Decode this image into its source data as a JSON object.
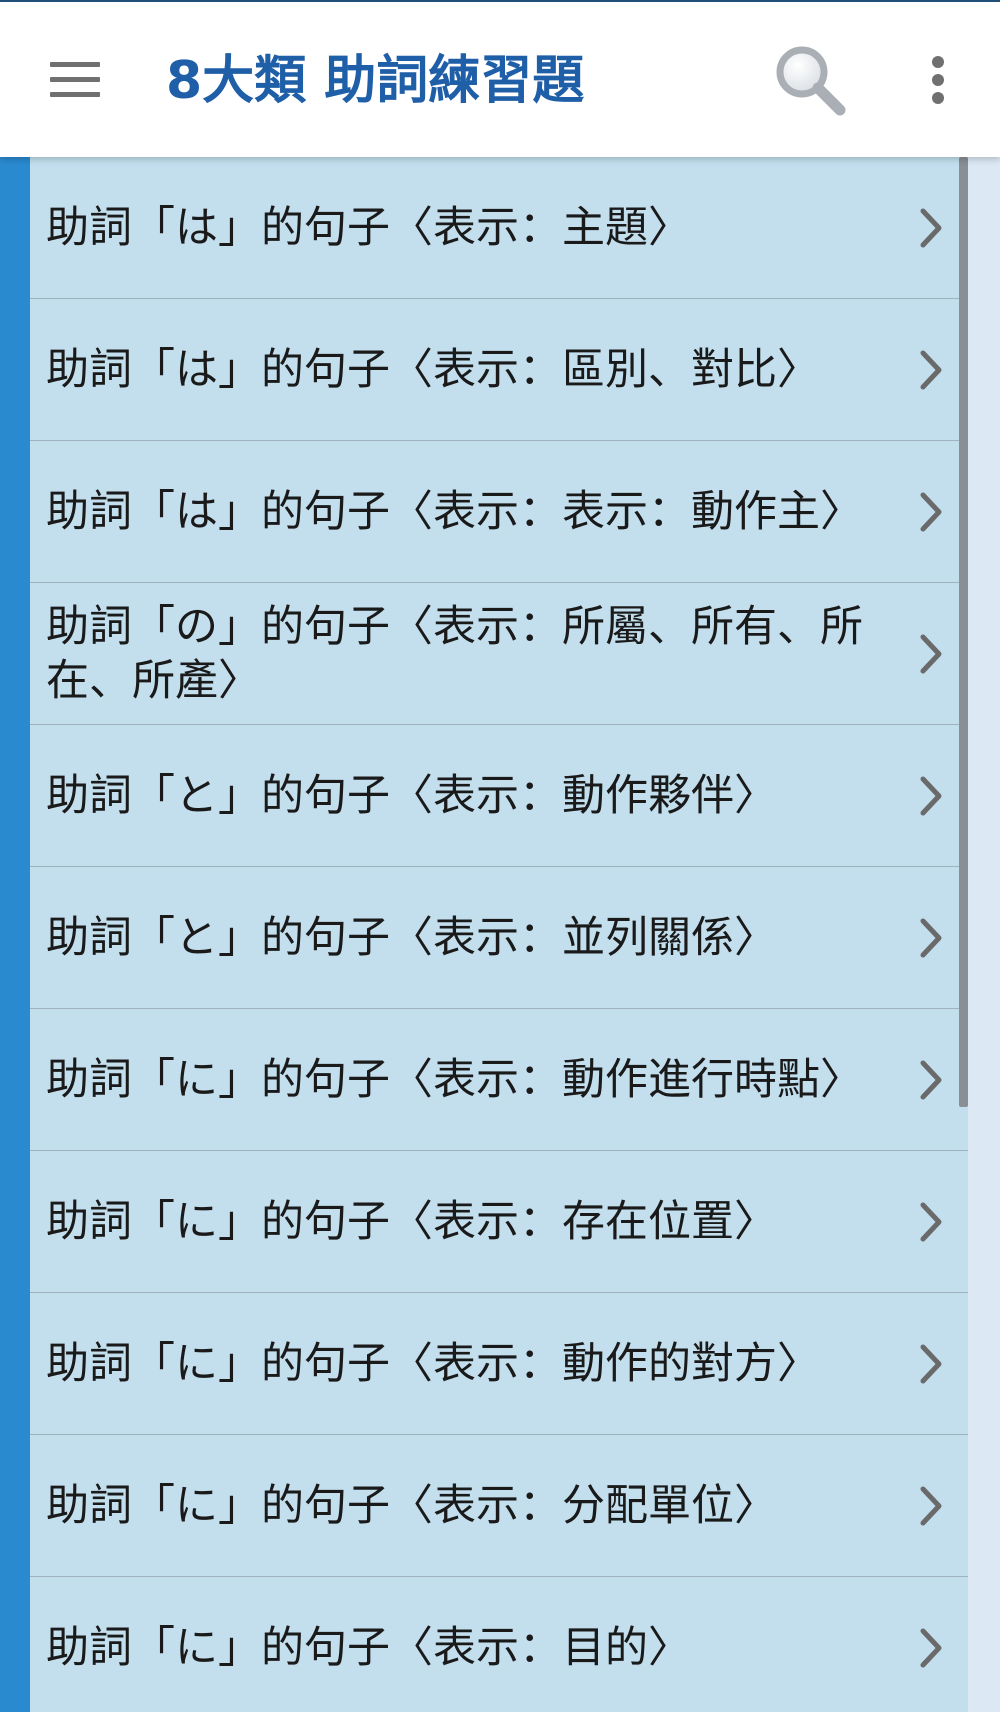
{
  "app_bar": {
    "title": "8大類 助詞練習題",
    "menu_icon": "hamburger-menu-icon",
    "search_icon": "search-icon",
    "more_icon": "more-vertical-icon"
  },
  "colors": {
    "app_bar_bg": "#ffffff",
    "title": "#1f5fa8",
    "accent_strip": "#2a8ad0",
    "row_bg": "#c3dfee",
    "row_divider": "#9fb2c0",
    "row_text": "#1a1a1a",
    "chevron": "#6a6a6a"
  },
  "list": {
    "items": [
      {
        "label": "助詞「は」的句子〈表示：主題〉"
      },
      {
        "label": "助詞「は」的句子〈表示：區別、對比〉"
      },
      {
        "label": "助詞「は」的句子〈表示：表示：動作主〉"
      },
      {
        "label": "助詞「の」的句子〈表示：所屬、所有、所在、所產〉"
      },
      {
        "label": "助詞「と」的句子〈表示：動作夥伴〉"
      },
      {
        "label": "助詞「と」的句子〈表示：並列關係〉"
      },
      {
        "label": "助詞「に」的句子〈表示：動作進行時點〉"
      },
      {
        "label": "助詞「に」的句子〈表示：存在位置〉"
      },
      {
        "label": "助詞「に」的句子〈表示：動作的對方〉"
      },
      {
        "label": "助詞「に」的句子〈表示：分配單位〉"
      },
      {
        "label": "助詞「に」的句子〈表示：目的〉"
      }
    ],
    "chevron_icon": "chevron-right-icon"
  }
}
